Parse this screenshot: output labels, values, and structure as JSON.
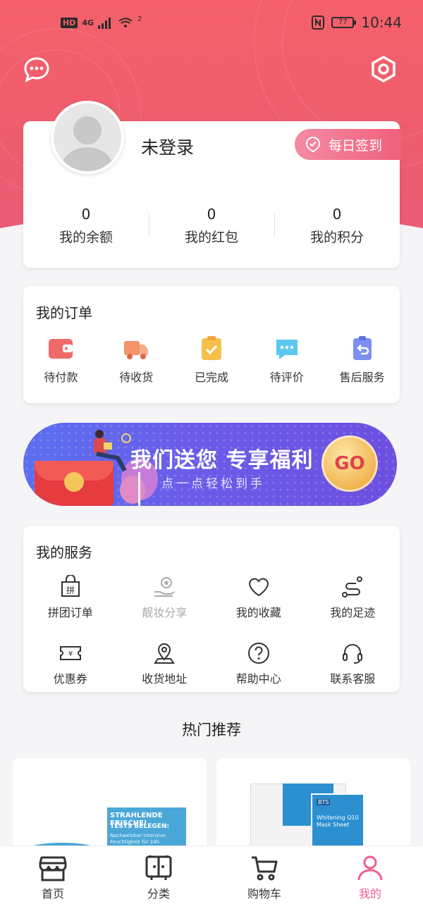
{
  "status_bar": {
    "network": "4G",
    "hd_label": "HD",
    "wifi_label": "2",
    "battery": "77",
    "time": "10:44"
  },
  "colors": {
    "brand": "#ee5d6e",
    "accent_pink": "#f1608a",
    "banner_blue": "#5b6ff0"
  },
  "header": {
    "message_icon": "chat-bubble-icon",
    "settings_icon": "gear-icon"
  },
  "user": {
    "name": "未登录",
    "checkin_label": "每日签到",
    "stats": [
      {
        "value": "0",
        "label": "我的余额"
      },
      {
        "value": "0",
        "label": "我的红包"
      },
      {
        "value": "0",
        "label": "我的积分"
      }
    ]
  },
  "orders": {
    "title": "我的订单",
    "items": [
      {
        "label": "待付款",
        "icon": "wallet-icon"
      },
      {
        "label": "待收货",
        "icon": "truck-icon"
      },
      {
        "label": "已完成",
        "icon": "clipboard-check-icon"
      },
      {
        "label": "待评价",
        "icon": "comment-icon"
      },
      {
        "label": "售后服务",
        "icon": "return-icon"
      }
    ]
  },
  "banner": {
    "main_text": "我们送您 专享福利",
    "sub_text": "点一点轻松到手",
    "button": "GO"
  },
  "services": {
    "title": "我的服务",
    "items": [
      {
        "label": "拼团订单",
        "icon": "group-bag-icon"
      },
      {
        "label": "靓妆分享",
        "icon": "share-hand-icon"
      },
      {
        "label": "我的收藏",
        "icon": "heart-icon"
      },
      {
        "label": "我的足迹",
        "icon": "footprint-path-icon"
      },
      {
        "label": "优惠券",
        "icon": "coupon-icon"
      },
      {
        "label": "收货地址",
        "icon": "location-pin-icon"
      },
      {
        "label": "帮助中心",
        "icon": "question-icon"
      },
      {
        "label": "联系客服",
        "icon": "headset-icon"
      }
    ]
  },
  "hot": {
    "title": "热门推荐",
    "products": [
      {
        "box_title": "STRAHLENDE FRISCHE!",
        "box_sub": "TESTS BELEGEN:",
        "box_text": "Nachweisbar intensive Feuchtigkeit für 24h"
      },
      {
        "brand": "BTS",
        "box_text": "Whitening Q10 Mask Sheet"
      }
    ]
  },
  "tabbar": [
    {
      "label": "首页",
      "icon": "shop-icon"
    },
    {
      "label": "分类",
      "icon": "category-icon"
    },
    {
      "label": "购物车",
      "icon": "cart-icon"
    },
    {
      "label": "我的",
      "icon": "person-icon"
    }
  ]
}
